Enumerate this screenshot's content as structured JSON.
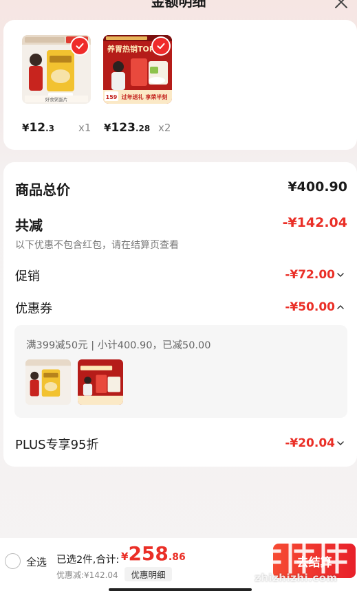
{
  "header": {
    "title": "金额明细"
  },
  "products": [
    {
      "price_currency": "¥",
      "price_int": "12",
      "price_dec": ".3",
      "qty": "x1",
      "caption": "好食粥蛋片"
    },
    {
      "price_currency": "¥",
      "price_int": "123",
      "price_dec": ".28",
      "qty": "x2",
      "headline": "养胃热销TOP",
      "banner": "过年送礼 享荣半刻",
      "tag": "159"
    }
  ],
  "summary": {
    "total_label": "商品总价",
    "total_value": "¥400.90",
    "reduce_label": "共减",
    "reduce_value": "-¥142.04",
    "note": "以下优惠不包含红包，请在结算页查看",
    "promo_label": "促销",
    "promo_value": "-¥72.00",
    "coupon_label": "优惠券",
    "coupon_value": "-¥50.00",
    "coupon_detail": "满399减50元 | 小计400.90，已减50.00",
    "plus_label": "PLUS专享95折",
    "plus_value": "-¥20.04"
  },
  "bottom": {
    "select_all": "全选",
    "selected_count": "已选2件,合计:",
    "total_currency": "¥",
    "total_int": "258",
    "total_dec": ".86",
    "discount": "优惠减:¥142.04",
    "detail_button": "优惠明细",
    "checkout_button": "去结算",
    "watermark_url": "zhizhizhi.com"
  },
  "colors": {
    "accent_red": "#ea2f27",
    "check_red": "#ef2b2b"
  },
  "icons": {
    "close": "close-icon",
    "checkmark": "checkmark-icon",
    "chevron_down": "chevron-down-icon",
    "chevron_up": "chevron-up-icon"
  }
}
